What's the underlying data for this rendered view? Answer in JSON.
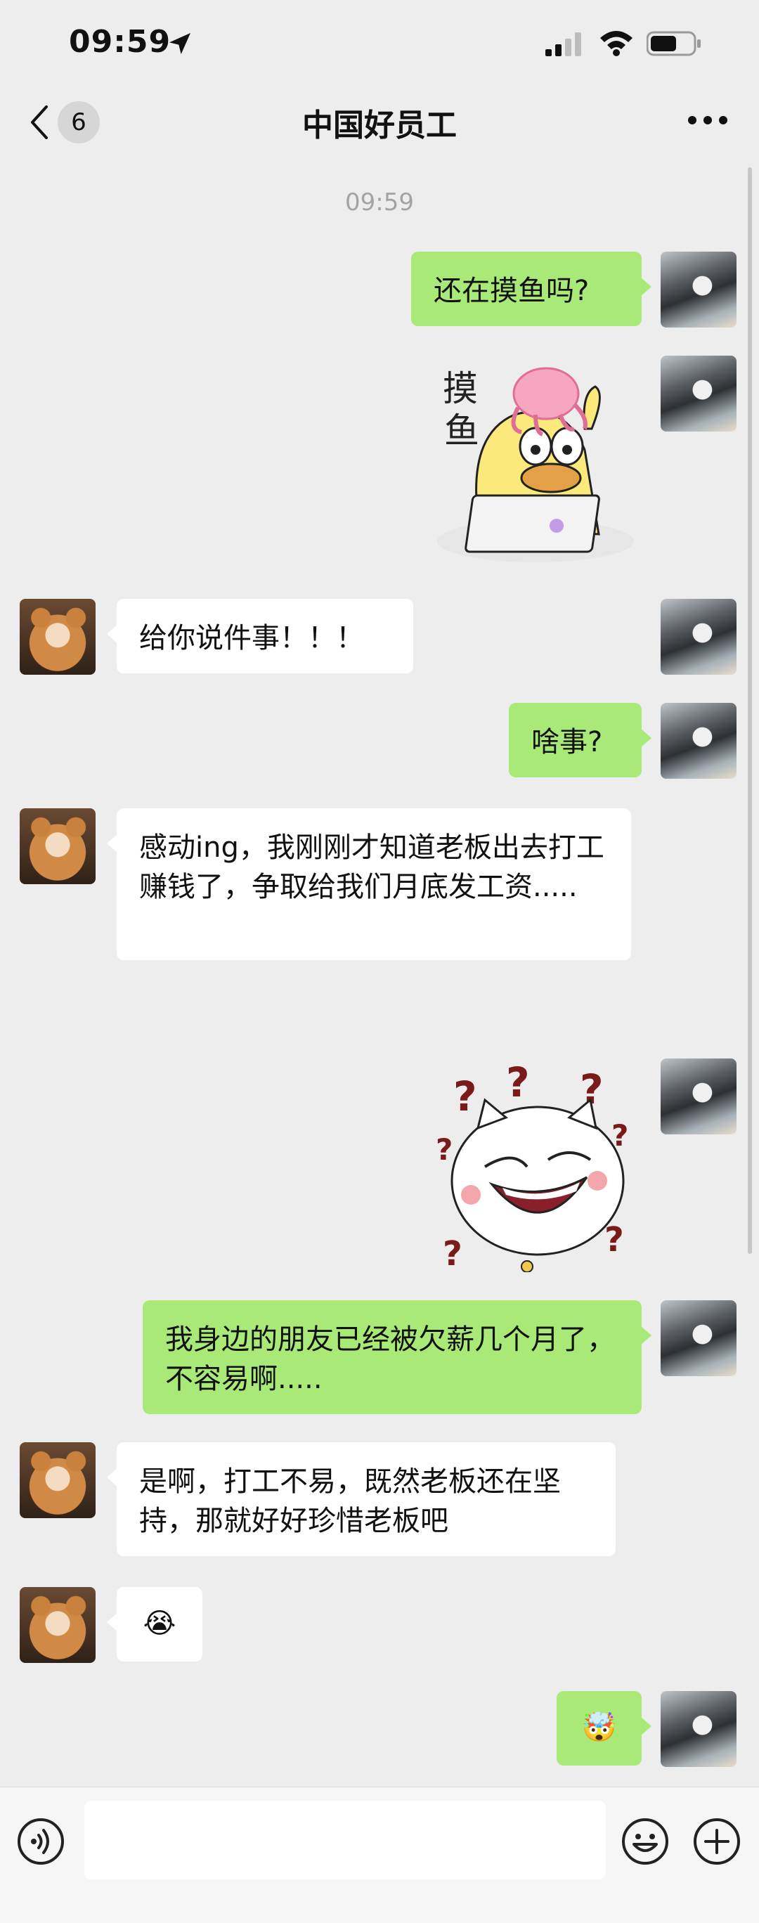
{
  "status_bar": {
    "time": "09:59"
  },
  "header": {
    "unread_count": "6",
    "title": "中国好员工"
  },
  "chat": {
    "timestamp": "09:59",
    "messages": [
      {
        "text": "还在摸鱼吗?"
      },
      {
        "sticker": "moyu-duck-sticker",
        "sticker_text": "摸鱼"
      },
      {
        "text": "给你说件事！！！"
      },
      {
        "text": "啥事?"
      },
      {
        "text": "感动ing，我刚刚才知道老板出去打工赚钱了，争取给我们月底发工资....."
      },
      {
        "sticker": "confused-cat-sticker",
        "sticker_text": "???"
      },
      {
        "text": "我身边的朋友已经被欠薪几个月了，不容易啊....."
      },
      {
        "text": "是啊，打工不易，既然老板还在坚持，那就好好珍惜老板吧"
      },
      {
        "emoji": "😭"
      },
      {
        "emoji": "🤯"
      }
    ]
  },
  "input": {
    "placeholder": ""
  },
  "colors": {
    "outgoing_bubble": "#a9e978",
    "incoming_bubble": "#ffffff",
    "background": "#ededed"
  }
}
